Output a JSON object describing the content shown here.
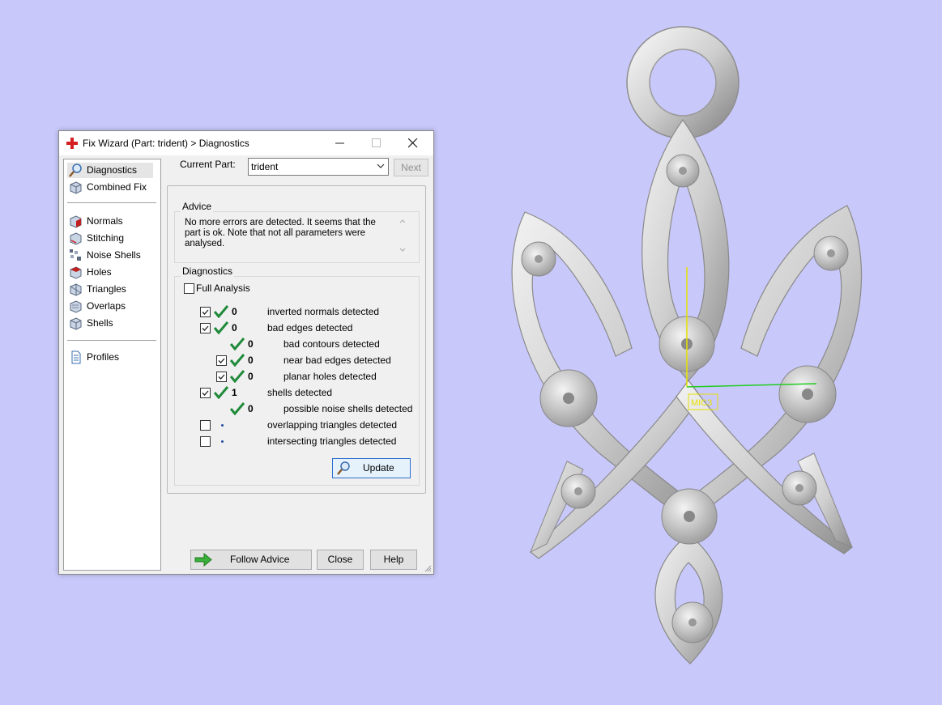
{
  "window": {
    "title": "Fix Wizard (Part: trident) > Diagnostics"
  },
  "nav": {
    "items": [
      {
        "label": "Diagnostics"
      },
      {
        "label": "Combined Fix"
      },
      {
        "label": "Normals"
      },
      {
        "label": "Stitching"
      },
      {
        "label": "Noise Shells"
      },
      {
        "label": "Holes"
      },
      {
        "label": "Triangles"
      },
      {
        "label": "Overlaps"
      },
      {
        "label": "Shells"
      },
      {
        "label": "Profiles"
      }
    ],
    "selected": "Diagnostics"
  },
  "current_part": {
    "label": "Current Part:",
    "value": "trident",
    "next_label": "Next"
  },
  "advice": {
    "title": "Advice",
    "text": "No more errors are detected. It seems that the part is ok. Note that not all parameters were analysed."
  },
  "diagnostics": {
    "title": "Diagnostics",
    "full_analysis_label": "Full Analysis",
    "full_analysis_checked": false,
    "rows": [
      {
        "checkbox": true,
        "checked": true,
        "status": "ok",
        "count": "0",
        "label": "inverted normals detected"
      },
      {
        "checkbox": true,
        "checked": true,
        "status": "ok",
        "count": "0",
        "label": "bad edges detected"
      },
      {
        "checkbox": false,
        "checked": false,
        "status": "ok",
        "count": "0",
        "label": "bad contours detected"
      },
      {
        "checkbox": true,
        "checked": true,
        "status": "ok",
        "count": "0",
        "label": "near bad edges detected"
      },
      {
        "checkbox": true,
        "checked": true,
        "status": "ok",
        "count": "0",
        "label": "planar holes detected"
      },
      {
        "checkbox": true,
        "checked": true,
        "status": "ok",
        "count": "1",
        "label": "shells detected"
      },
      {
        "checkbox": false,
        "checked": false,
        "status": "ok",
        "count": "0",
        "label": "possible noise shells detected"
      },
      {
        "checkbox": true,
        "checked": false,
        "status": "pending",
        "count": "",
        "label": "overlapping triangles detected"
      },
      {
        "checkbox": true,
        "checked": false,
        "status": "pending",
        "count": "",
        "label": "intersecting triangles detected"
      }
    ],
    "update_label": "Update"
  },
  "footer": {
    "follow_advice_label": "Follow Advice",
    "close_label": "Close",
    "help_label": "Help"
  },
  "viewport": {
    "background": "#c8c8fa",
    "model_name": "trident",
    "axis_label": "MIC3",
    "colors": {
      "x_axis": "#22cc22",
      "y_axis": "#e8e000",
      "model": "#cfcfcf"
    }
  }
}
